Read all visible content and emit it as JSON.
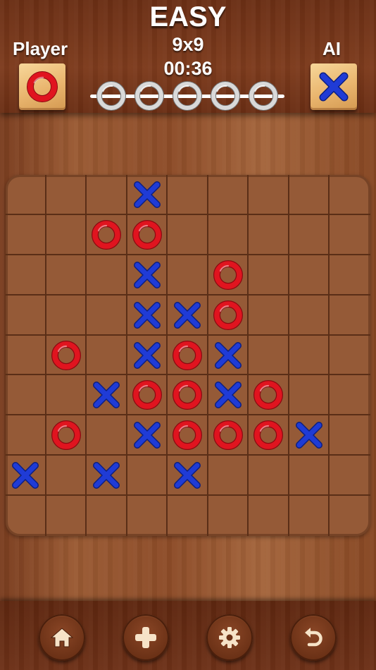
{
  "header": {
    "difficulty": "EASY",
    "board_size": "9x9",
    "timer": "00:36",
    "player_label": "Player",
    "ai_label": "AI",
    "player_symbol": "O",
    "ai_symbol": "X"
  },
  "progress": {
    "total": 5,
    "filled": 0
  },
  "colors": {
    "o": "#e0141f",
    "x": "#1f3bd6",
    "board": "#955a37",
    "grid": "#5a2e17"
  },
  "board": {
    "rows": 9,
    "cols": 9,
    "cells": [
      "...X.....",
      "..OO.....",
      "...X.O...",
      "...XXO...",
      ".O.XOX...",
      "..XOOXO..",
      ".O.XOOOX.",
      "X.X.X....",
      "........."
    ]
  },
  "toolbar": {
    "buttons": [
      {
        "name": "home-button",
        "icon": "home-icon"
      },
      {
        "name": "new-game-button",
        "icon": "plus-icon"
      },
      {
        "name": "settings-button",
        "icon": "gear-icon"
      },
      {
        "name": "undo-button",
        "icon": "undo-icon"
      }
    ]
  }
}
